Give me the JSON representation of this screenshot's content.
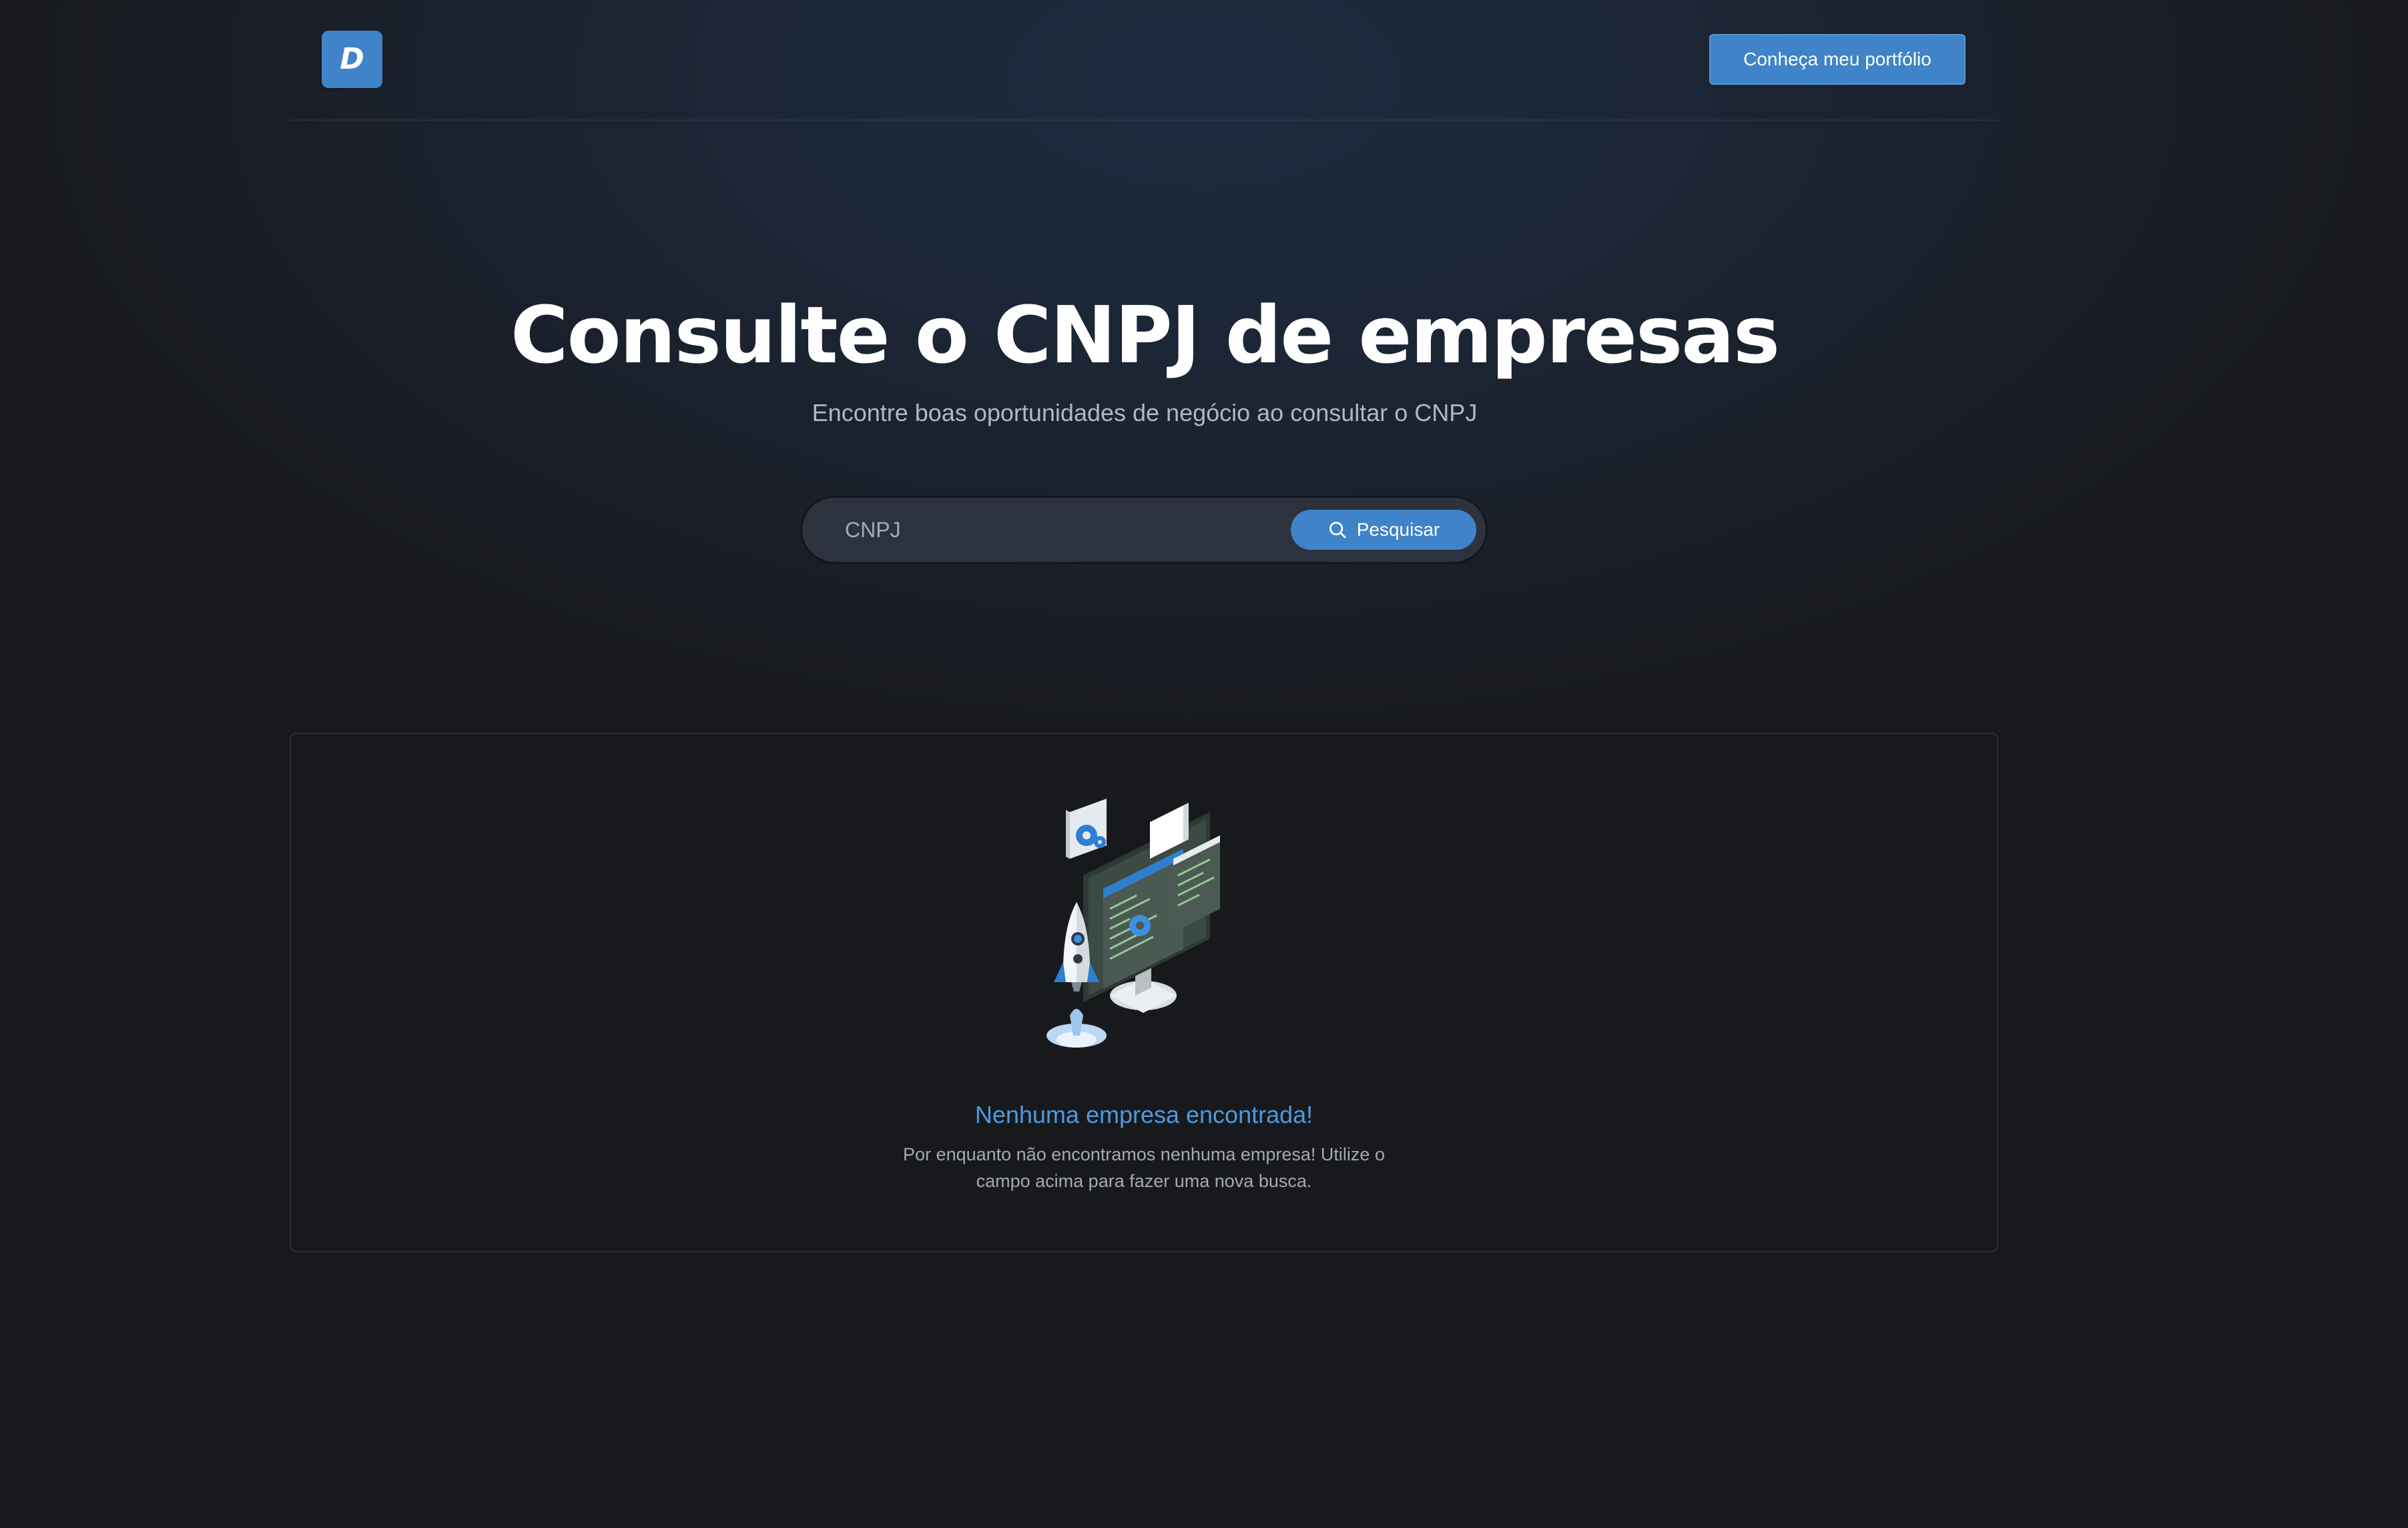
{
  "header": {
    "logo_letter": "D",
    "portfolio_button_label": "Conheça meu portfólio"
  },
  "hero": {
    "title": "Consulte o CNPJ de empresas",
    "subtitle": "Encontre boas oportunidades de negócio ao consultar o CNPJ"
  },
  "search": {
    "placeholder": "CNPJ",
    "value": "",
    "button_label": "Pesquisar",
    "button_icon": "search-icon"
  },
  "results": {
    "illustration": "rocket-computer-illustration",
    "empty_title": "Nenhuma empresa encontrada!",
    "empty_description": "Por enquanto não encontramos nenhuma empresa! Utilize o campo acima para fazer uma nova busca."
  },
  "colors": {
    "accent": "#3f83c8",
    "empty_title": "#4d9ae0",
    "background": "#18191c"
  }
}
